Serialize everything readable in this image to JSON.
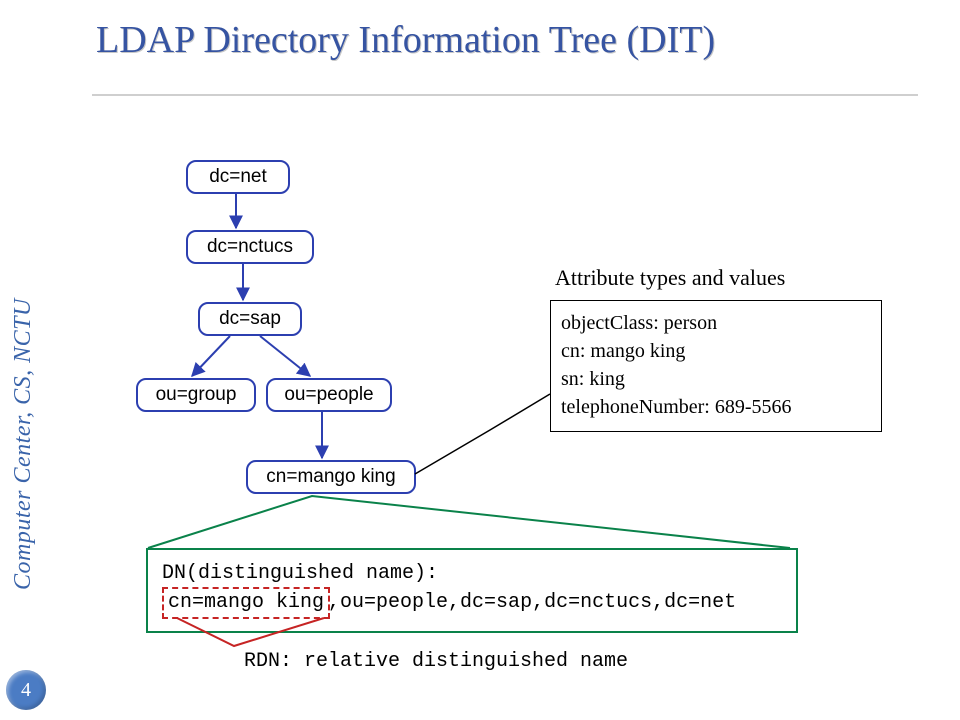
{
  "sidebar": {
    "text": "Computer Center, CS, NCTU",
    "page_number": "4"
  },
  "title": "LDAP Directory Information Tree (DIT)",
  "tree": {
    "nodes": {
      "dc_net": "dc=net",
      "dc_nctucs": "dc=nctucs",
      "dc_sap": "dc=sap",
      "ou_group": "ou=group",
      "ou_people": "ou=people",
      "cn_mango": "cn=mango king"
    }
  },
  "attributes": {
    "title": "Attribute types and values",
    "lines": {
      "l1": "objectClass: person",
      "l2": "cn: mango king",
      "l3": "sn: king",
      "l4": "telephoneNumber: 689-5566"
    }
  },
  "dn": {
    "line1": "DN(distinguished name):",
    "rdn": "cn=mango king",
    "rest": ",ou=people,dc=sap,dc=nctucs,dc=net"
  },
  "rdn_label": "RDN: relative distinguished name"
}
